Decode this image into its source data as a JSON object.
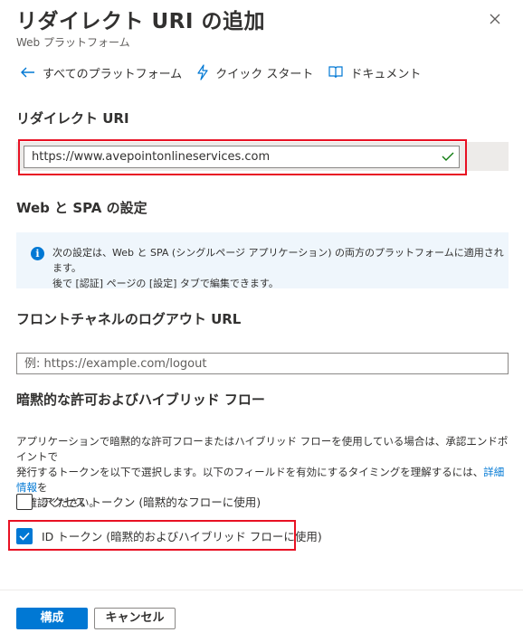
{
  "header": {
    "title": "リダイレクト URI の追加",
    "subtitle": "Web プラットフォーム"
  },
  "commands": {
    "all_platforms": "すべてのプラットフォーム",
    "quickstart": "クイック スタート",
    "docs": "ドキュメント"
  },
  "redirect_uri": {
    "label": "リダイレクト URI",
    "value": "https://www.avepointonlineservices.com"
  },
  "web_spa": {
    "label": "Web と SPA の設定",
    "info_line1": "次の設定は、Web と SPA (シングルページ アプリケーション) の両方のプラットフォームに適用されます。",
    "info_line2": "後で [認証] ページの [設定] タブで編集できます。"
  },
  "logout": {
    "label": "フロントチャネルのログアウト URL",
    "placeholder": "例: https://example.com/logout"
  },
  "implicit": {
    "label": "暗黙的な許可およびハイブリッド フロー",
    "desc_line1": "アプリケーションで暗黙的な許可フローまたはハイブリッド フローを使用している場合は、承認エンドポイントで",
    "desc_line2_pre": "発行するトークンを以下で選択します。以下のフィールドを有効にするタイミングを理解するには、",
    "desc_link": "詳細情報",
    "desc_line2_post": "を",
    "desc_line3": "ご確認ください。",
    "access_token": {
      "label": "アクセス トークン (暗黙的なフローに使用)",
      "checked": false
    },
    "id_token": {
      "label": "ID トークン (暗黙的およびハイブリッド フローに使用)",
      "checked": true
    }
  },
  "footer": {
    "configure": "構成",
    "cancel": "キャンセル"
  },
  "colors": {
    "accent": "#0078d4",
    "highlight": "#e81123",
    "success": "#107c10"
  }
}
